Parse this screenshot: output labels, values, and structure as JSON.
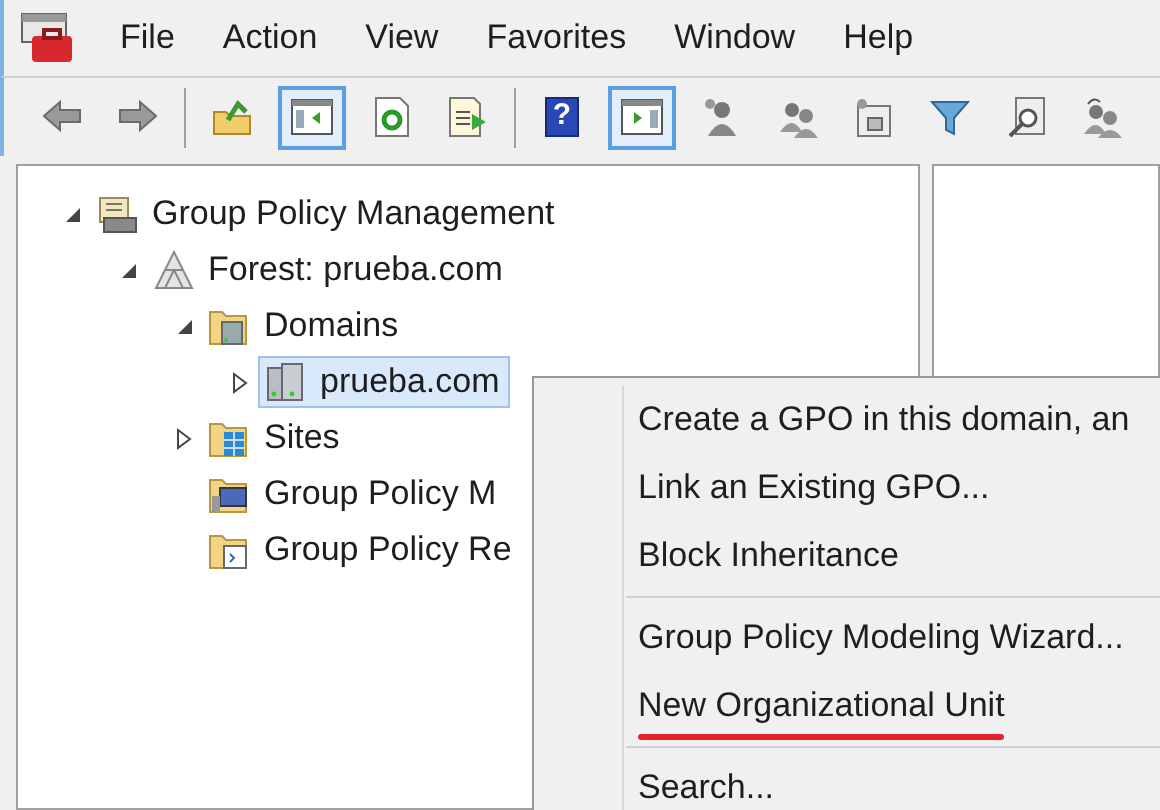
{
  "menu_bar": [
    "File",
    "Action",
    "View",
    "Favorites",
    "Window",
    "Help"
  ],
  "toolbar": [
    {
      "kind": "back",
      "pressed": false
    },
    {
      "kind": "forward",
      "pressed": false
    },
    {
      "kind": "separator"
    },
    {
      "kind": "up",
      "pressed": false
    },
    {
      "kind": "tree-pane",
      "pressed": true
    },
    {
      "kind": "refresh",
      "pressed": false
    },
    {
      "kind": "export",
      "pressed": false
    },
    {
      "kind": "separator"
    },
    {
      "kind": "help",
      "pressed": false,
      "label": "?"
    },
    {
      "kind": "action-pane",
      "pressed": true
    },
    {
      "kind": "user",
      "pressed": false
    },
    {
      "kind": "users",
      "pressed": false
    },
    {
      "kind": "unit",
      "pressed": false
    },
    {
      "kind": "filter",
      "pressed": false
    },
    {
      "kind": "find",
      "pressed": false
    },
    {
      "kind": "delegate",
      "pressed": false
    }
  ],
  "tree": [
    {
      "label": "Group Policy Management",
      "kind": "console",
      "expanded": true,
      "selected": false,
      "children": [
        {
          "label": "Forest: prueba.com",
          "kind": "forest",
          "expanded": true,
          "selected": false,
          "children": [
            {
              "label": "Domains",
              "kind": "domains",
              "expanded": true,
              "selected": false,
              "children": [
                {
                  "label": "prueba.com",
                  "kind": "domain",
                  "expanded": false,
                  "selected": true
                }
              ]
            },
            {
              "label": "Sites",
              "kind": "sites",
              "expanded": false,
              "selected": false
            },
            {
              "label": "Group Policy M",
              "kind": "modeling",
              "selected": false
            },
            {
              "label": "Group Policy Re",
              "kind": "results",
              "selected": false
            }
          ]
        }
      ]
    }
  ],
  "context_menu": [
    [
      {
        "label": "Create a GPO in this domain, an",
        "annotated": false
      },
      {
        "label": "Link an Existing GPO...",
        "annotated": false
      },
      {
        "label": "Block Inheritance",
        "annotated": false
      }
    ],
    [
      {
        "label": "Group Policy Modeling Wizard...",
        "annotated": false
      },
      {
        "label": "New Organizational Unit",
        "annotated": true
      }
    ],
    [
      {
        "label": "Search...",
        "annotated": false
      }
    ]
  ]
}
